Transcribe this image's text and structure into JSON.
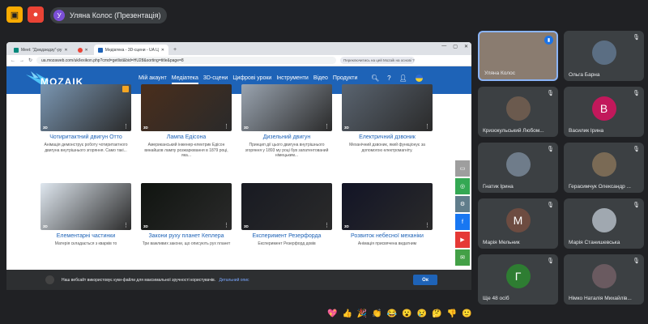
{
  "meet": {
    "presenter": "Уляна Колос (Презентація)",
    "presenter_initial": "У",
    "colors": {
      "accent": "#f9ab00",
      "record": "#ea4335"
    }
  },
  "browser": {
    "tabs": [
      {
        "label": "Meet: \"Дзюдзюдзу\"-ру",
        "active": false
      },
      {
        "label": "",
        "active": false
      },
      {
        "label": "Медіатека - 3D-сцени - UA Ц",
        "active": true
      }
    ],
    "url": "ua.mozaweb.com/uk/lexikon.php?cmd=getlist&bid=HU28&sorting=title&page=8",
    "search_placeholder": "Переключитись на цей Mozaik на основі ?"
  },
  "site": {
    "logo": "MOZAIK",
    "menu": [
      "Мій акаунт",
      "Медіатека",
      "3D-сцени",
      "Цифрові уроки",
      "Інструменти",
      "Відео",
      "Продукти"
    ],
    "active_menu": "Медіатека",
    "cards": [
      {
        "title": "Чотиритактний двигун Отто",
        "desc": "Анімація демонструє роботу чотиритактного двигуна внутрішнього згоряння. Само такі...",
        "color": "#7a96b2"
      },
      {
        "title": "Лампа Едісона",
        "desc": "Американський інженер-електрик Едісон винайшов лампу розжарювання в 1879 році, яка...",
        "color": "#4a2e1c"
      },
      {
        "title": "Дизельний двигун",
        "desc": "Принцип дії цього двигуна внутрішнього згоряння у 1893 му році був запатентований німецьким...",
        "color": "#9aa4b0"
      },
      {
        "title": "Електричний дзвоник",
        "desc": "Механічний дзвоник, який функціонує за допомогою електромагніту.",
        "color": "#5a6470"
      },
      {
        "title": "Елементарні частинки",
        "desc": "Матерія складається з кварків то",
        "color": "#dfe7ef"
      },
      {
        "title": "Закони руху планет Кеплера",
        "desc": "Три важливих закони, що описують рух планет",
        "color": "#101410"
      },
      {
        "title": "Експеримент Резерфорда",
        "desc": "Експеримент Резерфорд довів",
        "color": "#181a22"
      },
      {
        "title": "Розвиток небесної механіки",
        "desc": "Анімація присвячена видатним",
        "color": "#121426"
      }
    ],
    "cookie_text": "Наш вебсайт використовує куки-файли для максимальної зручності користувачів.",
    "cookie_link": "Детальний опис",
    "ok_label": "Ок"
  },
  "participants": [
    {
      "name": "Уляна Колос",
      "initial": "",
      "color": "#8a7c70",
      "speaking": true
    },
    {
      "name": "Ольга Барна",
      "initial": "",
      "color": "#5b6e83"
    },
    {
      "name": "Кризокульський Любом...",
      "initial": "",
      "color": "#6b5a4e"
    },
    {
      "name": "Василик Ірина",
      "initial": "В",
      "color": "#c2185b"
    },
    {
      "name": "Гнатик Ірина",
      "initial": "",
      "color": "#6f7c8a"
    },
    {
      "name": "Герасимчук Олександр ...",
      "initial": "",
      "color": "#7a6a55"
    },
    {
      "name": "Марія Мельник",
      "initial": "М",
      "color": "#6d4c41"
    },
    {
      "name": "Марія Станишевська",
      "initial": "",
      "color": "#a0a8b0"
    },
    {
      "name": "Ще 48 осіб",
      "initial": "Г",
      "color": "#2e7d32"
    },
    {
      "name": "Німко Наталія Михайлів...",
      "initial": "",
      "color": "#6a5a60"
    }
  ],
  "reactions": [
    "💖",
    "👍",
    "🎉",
    "👏",
    "😂",
    "😮",
    "😢",
    "🤔",
    "👎",
    "🙂"
  ]
}
